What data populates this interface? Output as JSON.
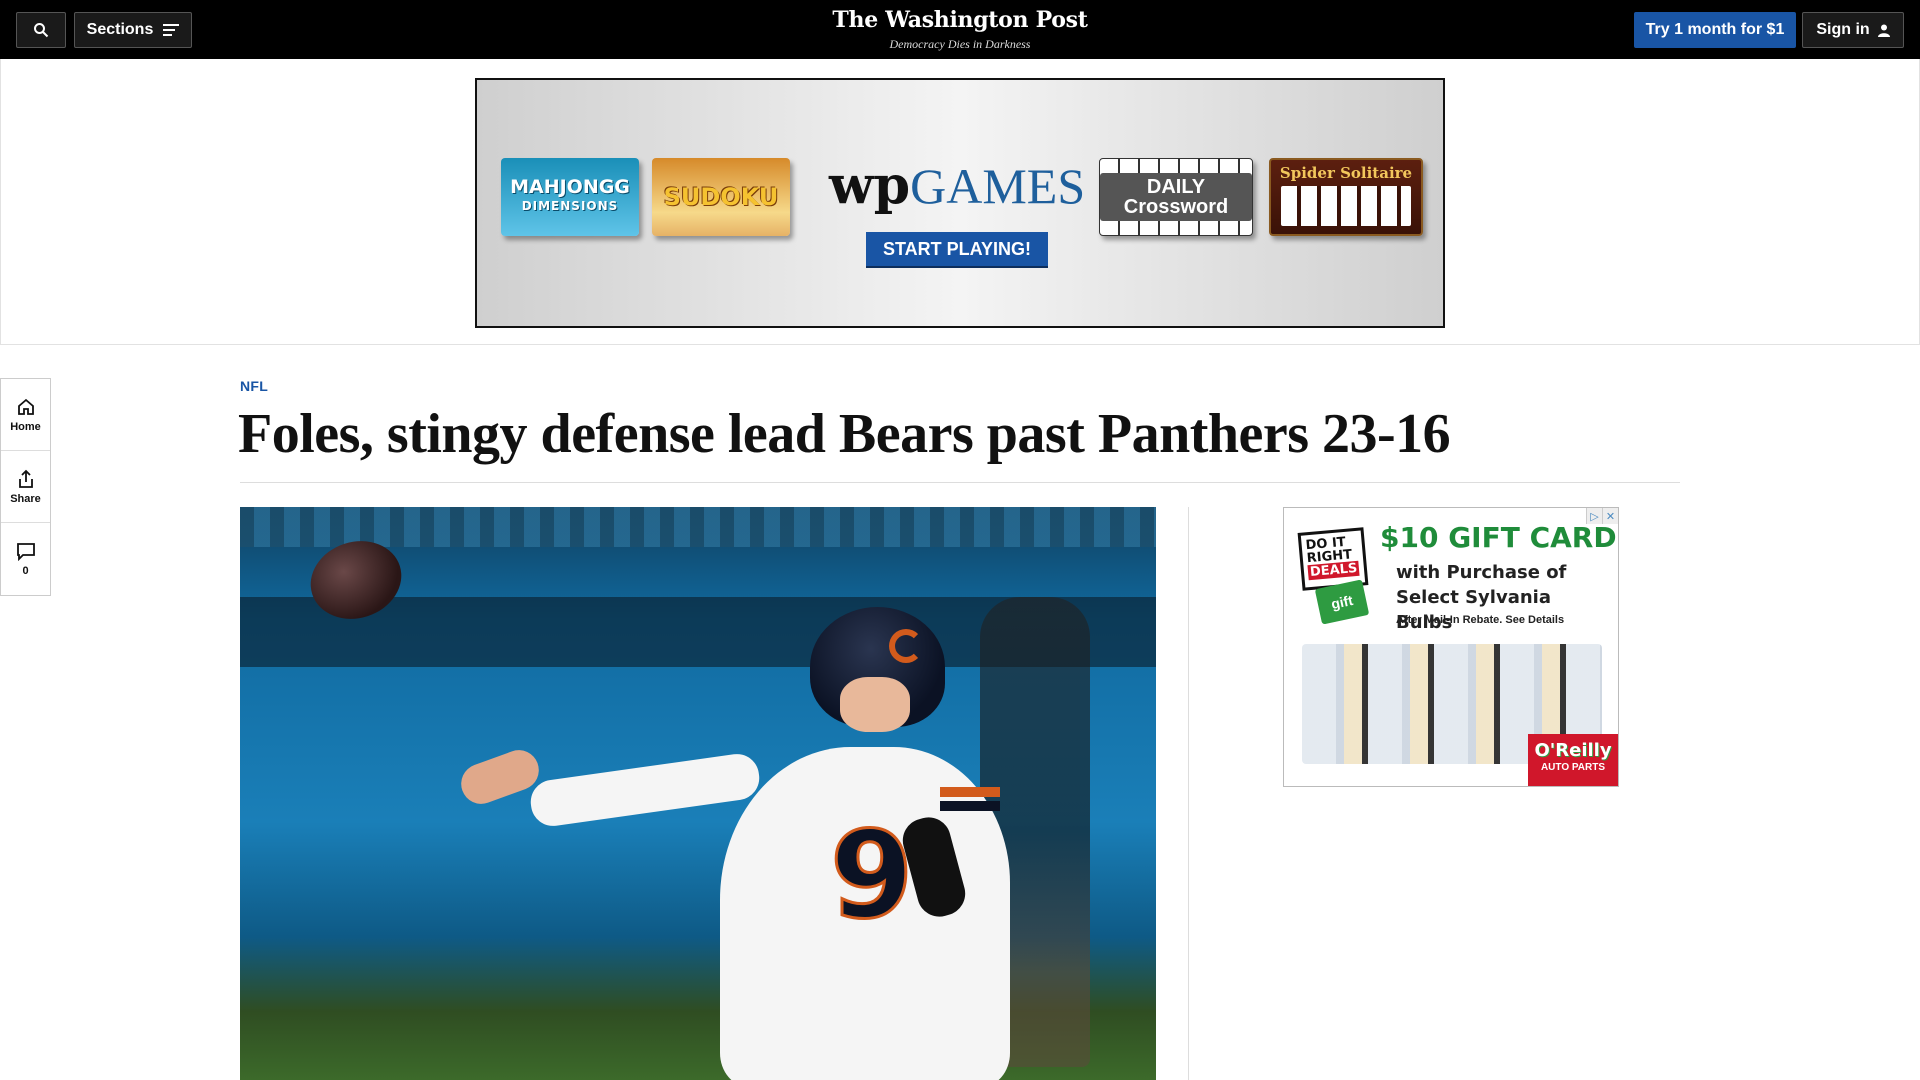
{
  "header": {
    "sections_label": "Sections",
    "logo": "The Washington Post",
    "tagline": "Democracy Dies in Darkness",
    "subscribe_label": "Try 1 month for $1",
    "signin_label": "Sign in"
  },
  "top_ad": {
    "tiles": [
      "MAHJONGG",
      "DIMENSIONS",
      "SUDOKU",
      "DAILY Crossword",
      "Spider Solitaire"
    ],
    "brand_wp": "wp",
    "brand_games": "GAMES",
    "cta": "START PLAYING!"
  },
  "rail": {
    "home_label": "Home",
    "share_label": "Share",
    "comments_count": "0"
  },
  "article": {
    "kicker": "NFL",
    "headline": "Foles, stingy defense lead Bears past Panthers 23-16",
    "jersey_number": "9"
  },
  "side_ad": {
    "badge_line1": "DO IT",
    "badge_line2": "RIGHT",
    "badge_line3": "DEALS",
    "gift_tag": "gift",
    "headline": "$10 GIFT CARD",
    "sub": "with Purchase of Select Sylvania Bulbs",
    "fine_print": "After Mail-In Rebate. See Details",
    "brand": "O'Reilly",
    "brand_sub": "AUTO PARTS"
  },
  "colors": {
    "topbar": "#000000",
    "accent_blue": "#1955a5",
    "kicker_blue": "#1955a5"
  }
}
